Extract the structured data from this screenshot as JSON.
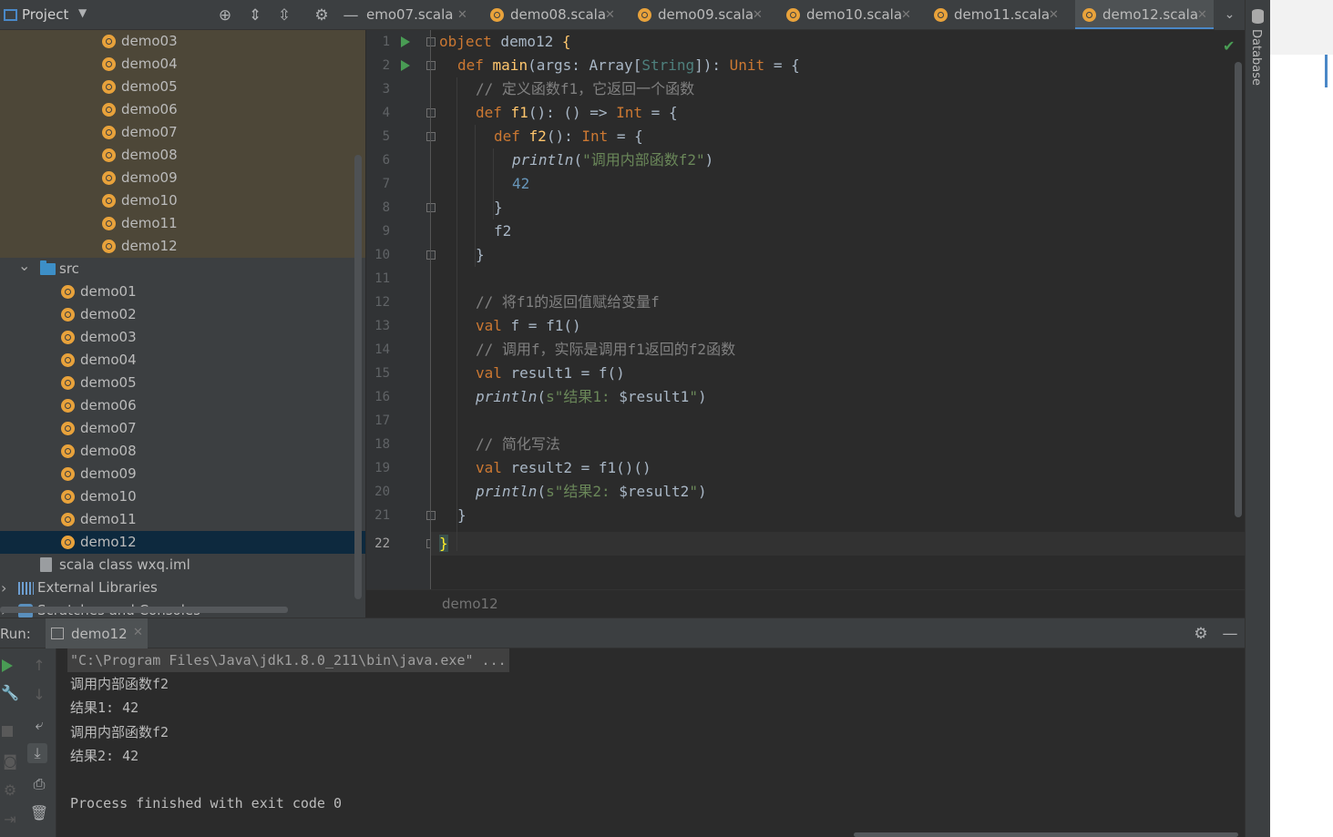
{
  "project": {
    "title": "Project",
    "tree_items": [
      {
        "label": "demo03",
        "kind": "object",
        "depth": 2,
        "highlight": true
      },
      {
        "label": "demo04",
        "kind": "object",
        "depth": 2,
        "highlight": true
      },
      {
        "label": "demo05",
        "kind": "object",
        "depth": 2,
        "highlight": true
      },
      {
        "label": "demo06",
        "kind": "object",
        "depth": 2,
        "highlight": true
      },
      {
        "label": "demo07",
        "kind": "object",
        "depth": 2,
        "highlight": true
      },
      {
        "label": "demo08",
        "kind": "object",
        "depth": 2,
        "highlight": true
      },
      {
        "label": "demo09",
        "kind": "object",
        "depth": 2,
        "highlight": true
      },
      {
        "label": "demo10",
        "kind": "object",
        "depth": 2,
        "highlight": true
      },
      {
        "label": "demo11",
        "kind": "object",
        "depth": 2,
        "highlight": true
      },
      {
        "label": "demo12",
        "kind": "object",
        "depth": 2,
        "highlight": true
      },
      {
        "label": "src",
        "kind": "folder",
        "depth": 1,
        "expanded": true
      },
      {
        "label": "demo01",
        "kind": "object",
        "depth": 2
      },
      {
        "label": "demo02",
        "kind": "object",
        "depth": 2
      },
      {
        "label": "demo03",
        "kind": "object",
        "depth": 2
      },
      {
        "label": "demo04",
        "kind": "object",
        "depth": 2
      },
      {
        "label": "demo05",
        "kind": "object",
        "depth": 2
      },
      {
        "label": "demo06",
        "kind": "object",
        "depth": 2
      },
      {
        "label": "demo07",
        "kind": "object",
        "depth": 2
      },
      {
        "label": "demo08",
        "kind": "object",
        "depth": 2
      },
      {
        "label": "demo09",
        "kind": "object",
        "depth": 2
      },
      {
        "label": "demo10",
        "kind": "object",
        "depth": 2
      },
      {
        "label": "demo11",
        "kind": "object",
        "depth": 2
      },
      {
        "label": "demo12",
        "kind": "object",
        "depth": 2,
        "selected": true
      },
      {
        "label": "scala class wxq.iml",
        "kind": "file",
        "depth": 1
      },
      {
        "label": "External Libraries",
        "kind": "library",
        "depth": 0
      },
      {
        "label": "Scratches and Consoles",
        "kind": "scratch",
        "depth": 0
      }
    ]
  },
  "tabs": [
    {
      "label": "emo07.scala"
    },
    {
      "label": "demo08.scala"
    },
    {
      "label": "demo09.scala"
    },
    {
      "label": "demo10.scala"
    },
    {
      "label": "demo11.scala"
    },
    {
      "label": "demo12.scala",
      "active": true
    }
  ],
  "editor": {
    "current_line": 22,
    "lines": [
      {
        "n": "1"
      },
      {
        "n": "2"
      },
      {
        "n": "3"
      },
      {
        "n": "4"
      },
      {
        "n": "5"
      },
      {
        "n": "6"
      },
      {
        "n": "7"
      },
      {
        "n": "8"
      },
      {
        "n": "9"
      },
      {
        "n": "10"
      },
      {
        "n": "11"
      },
      {
        "n": "12"
      },
      {
        "n": "13"
      },
      {
        "n": "14"
      },
      {
        "n": "15"
      },
      {
        "n": "16"
      },
      {
        "n": "17"
      },
      {
        "n": "18"
      },
      {
        "n": "19"
      },
      {
        "n": "20"
      },
      {
        "n": "21"
      },
      {
        "n": "22"
      }
    ],
    "code": {
      "l1_kw": "object",
      "l1_name": " demo12 ",
      "l1_brace": "{",
      "l2_kw": "def",
      "l2_fn": " main",
      "l2_a": "(args: ",
      "l2_t": "Array",
      "l2_b": "[",
      "l2_tp": "String",
      "l2_c": "]): ",
      "l2_u": "Unit",
      "l2_d": " = {",
      "l3": "// 定义函数f1，它返回一个函数",
      "l4_kw": "def",
      "l4_fn": " f1",
      "l4_a": "(): () => ",
      "l4_t": "Int",
      "l4_b": " = {",
      "l5_kw": "def",
      "l5_fn": " f2",
      "l5_a": "(): ",
      "l5_t": "Int",
      "l5_b": " = {",
      "l6_fn": "println",
      "l6_a": "(",
      "l6_s": "\"调用内部函数f2\"",
      "l6_b": ")",
      "l7": "42",
      "l8": "}",
      "l9": "f2",
      "l10": "}",
      "l12": "// 将f1的返回值赋给变量f",
      "l13_kw": "val",
      "l13_a": " f = f1()",
      "l14": "// 调用f，实际是调用f1返回的f2函数",
      "l15_kw": "val",
      "l15_a": " result1 = f()",
      "l16_fn": "println",
      "l16_a": "(",
      "l16_s": "s\"结果1: ",
      "l16_v": "$result1",
      "l16_e": "\"",
      "l16_b": ")",
      "l18": "// 简化写法",
      "l19_kw": "val",
      "l19_a": " result2 = f1()()",
      "l20_fn": "println",
      "l20_a": "(",
      "l20_s": "s\"结果2: ",
      "l20_v": "$result2",
      "l20_e": "\"",
      "l20_b": ")",
      "l21": "}",
      "l22": "}"
    },
    "breadcrumb": "demo12"
  },
  "right_stripe": {
    "label": "Database"
  },
  "run": {
    "label": "Run:",
    "tab_label": "demo12",
    "console": [
      "\"C:\\Program Files\\Java\\jdk1.8.0_211\\bin\\java.exe\" ...",
      "调用内部函数f2",
      "结果1: 42",
      "调用内部函数f2",
      "结果2: 42",
      "",
      "Process finished with exit code 0"
    ]
  },
  "colors": {
    "accent": "#4a88c7",
    "keyword": "#cc7832",
    "function": "#ffc66d",
    "string": "#6a8759",
    "number": "#6897bb",
    "comment": "#808080",
    "selection": "#0d293e",
    "run_green": "#499c54"
  }
}
